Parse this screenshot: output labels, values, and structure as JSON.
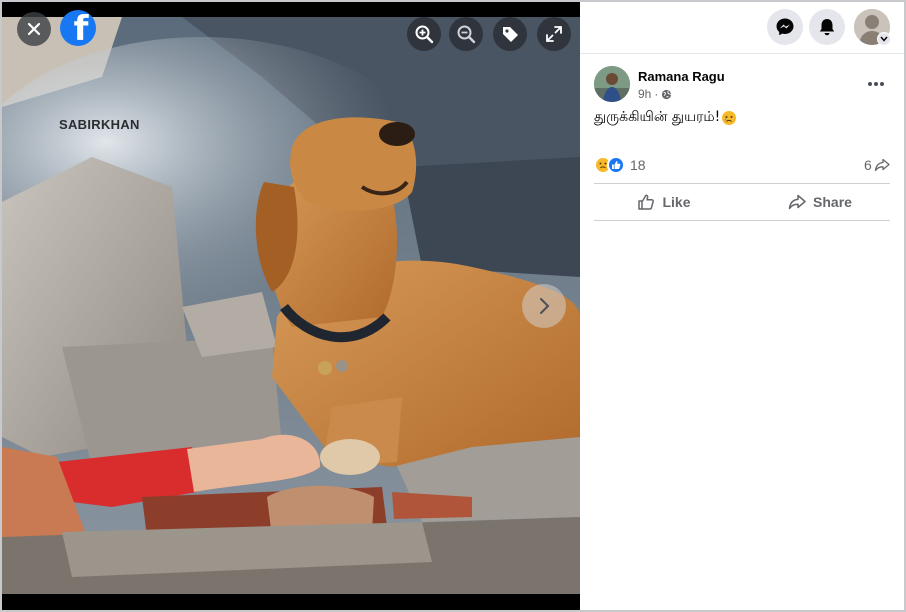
{
  "viewer": {
    "watermark": "SABIRKHAN",
    "icons": {
      "close": "close-icon",
      "brand": "facebook-logo-icon",
      "zoom_in": "zoom-in-icon",
      "zoom_out": "zoom-out-icon",
      "tag": "tag-icon",
      "fullscreen": "expand-icon",
      "next": "chevron-right-icon"
    },
    "brand_letter": "f"
  },
  "topbar": {
    "icons": {
      "messenger": "messenger-icon",
      "notifications": "bell-icon",
      "account": "account-avatar",
      "account_menu": "chevron-down-icon"
    }
  },
  "post": {
    "author": "Ramana Ragu",
    "time": "9h",
    "audience_icon": "globe-icon",
    "text": "துருக்கியின் துயரம்!",
    "text_emoji": "sad-face-emoji",
    "reaction_count": "18",
    "reaction_icons": [
      "sad-reaction-icon",
      "like-reaction-icon"
    ],
    "share_count": "6",
    "actions": {
      "like": "Like",
      "share": "Share"
    }
  },
  "colors": {
    "brand_blue": "#1877f2",
    "secondary_text": "#65676b",
    "reaction_yellow": "#f7b928"
  }
}
